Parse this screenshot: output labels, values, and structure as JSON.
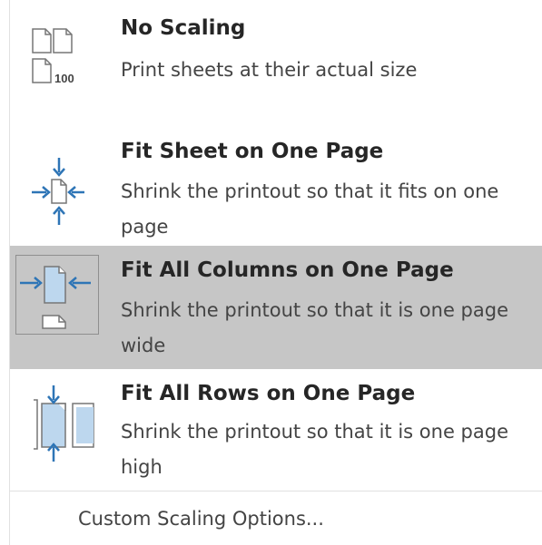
{
  "menu": {
    "items": [
      {
        "title": "No Scaling",
        "description": "Print sheets at their actual size",
        "icon": "no-scaling-icon",
        "icon_text": "100",
        "selected": false
      },
      {
        "title": "Fit Sheet on One Page",
        "description": "Shrink the printout so that it fits on one page",
        "icon": "fit-sheet-icon",
        "selected": false
      },
      {
        "title": "Fit All Columns on One Page",
        "description": "Shrink the printout so that it is one page wide",
        "icon": "fit-columns-icon",
        "selected": true
      },
      {
        "title": "Fit All Rows on One Page",
        "description": "Shrink the printout so that it is one page high",
        "icon": "fit-rows-icon",
        "selected": false
      }
    ],
    "custom_option": "Custom Scaling Options..."
  },
  "colors": {
    "selection_bg": "#c6c6c6",
    "arrow_blue": "#2e75b6",
    "page_fill_blue": "#bdd7ee",
    "icon_outline": "#767676"
  }
}
